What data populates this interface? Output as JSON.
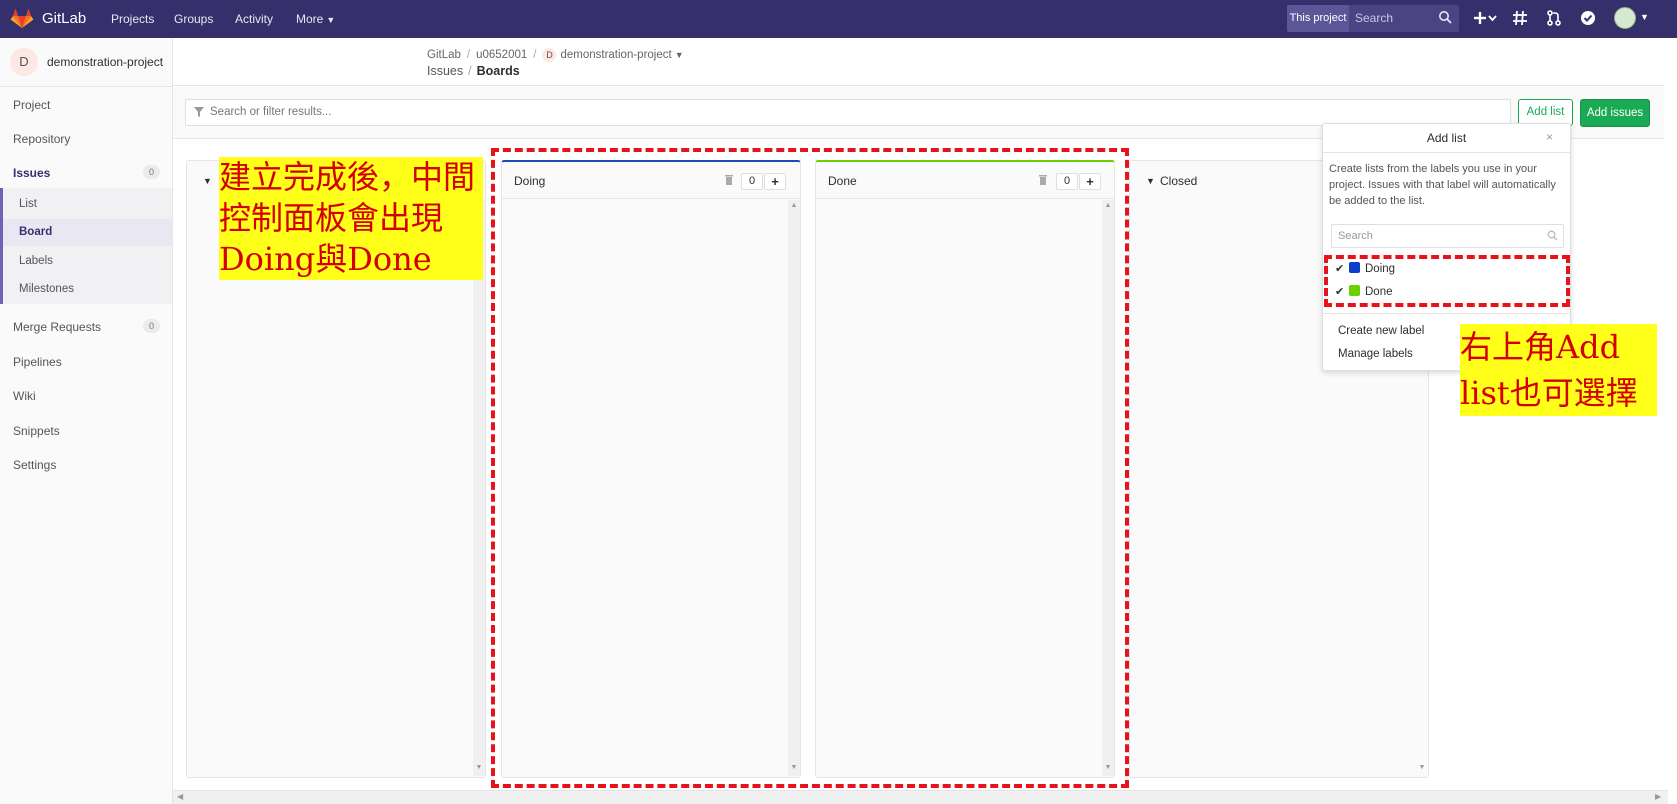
{
  "navbar": {
    "brand": "GitLab",
    "links": [
      "Projects",
      "Groups",
      "Activity",
      "More"
    ],
    "scope_label": "This project",
    "search_placeholder": "Search",
    "icons": [
      "plus-icon",
      "hash-icon",
      "merge-request-icon",
      "todo-check-icon",
      "user-avatar"
    ]
  },
  "sidebar": {
    "project_initial": "D",
    "project_name": "demonstration-project",
    "items": [
      {
        "label": "Project"
      },
      {
        "label": "Repository"
      },
      {
        "label": "Issues",
        "badge": "0",
        "active": true
      },
      {
        "label": "Merge Requests",
        "badge": "0"
      },
      {
        "label": "Pipelines"
      },
      {
        "label": "Wiki"
      },
      {
        "label": "Snippets"
      },
      {
        "label": "Settings"
      }
    ],
    "issues_sub": [
      {
        "label": "List"
      },
      {
        "label": "Board",
        "active": true
      },
      {
        "label": "Labels"
      },
      {
        "label": "Milestones"
      }
    ]
  },
  "breadcrumb": {
    "root": "GitLab",
    "user": "u0652001",
    "project_initial": "D",
    "project": "demonstration-project",
    "section": "Issues",
    "page": "Boards"
  },
  "filter": {
    "placeholder": "Search or filter results...",
    "add_list_label": "Add list",
    "add_issues_label": "Add issues"
  },
  "board": {
    "columns": [
      {
        "title": "Doing",
        "count": "0",
        "color": "#1e4ab7"
      },
      {
        "title": "Done",
        "count": "0",
        "color": "#69d100"
      },
      {
        "title": "Closed"
      }
    ]
  },
  "add_list_dropdown": {
    "title": "Add list",
    "close": "×",
    "description": "Create lists from the labels you use in your project. Issues with that label will automatically be added to the list.",
    "search_placeholder": "Search",
    "labels": [
      {
        "name": "Doing",
        "color": "#0b3ec9",
        "checked": true
      },
      {
        "name": "Done",
        "color": "#69d100",
        "checked": true
      }
    ],
    "links": [
      "Create new label",
      "Manage labels"
    ]
  },
  "annotations": {
    "left_note": "建立完成後，中間控制面板會出現Doing與Done",
    "right_note": "右上角Add list也可選擇",
    "highlight_color": "#ffff1a",
    "text_color": "#d40000",
    "border_color": "#e8131a"
  }
}
